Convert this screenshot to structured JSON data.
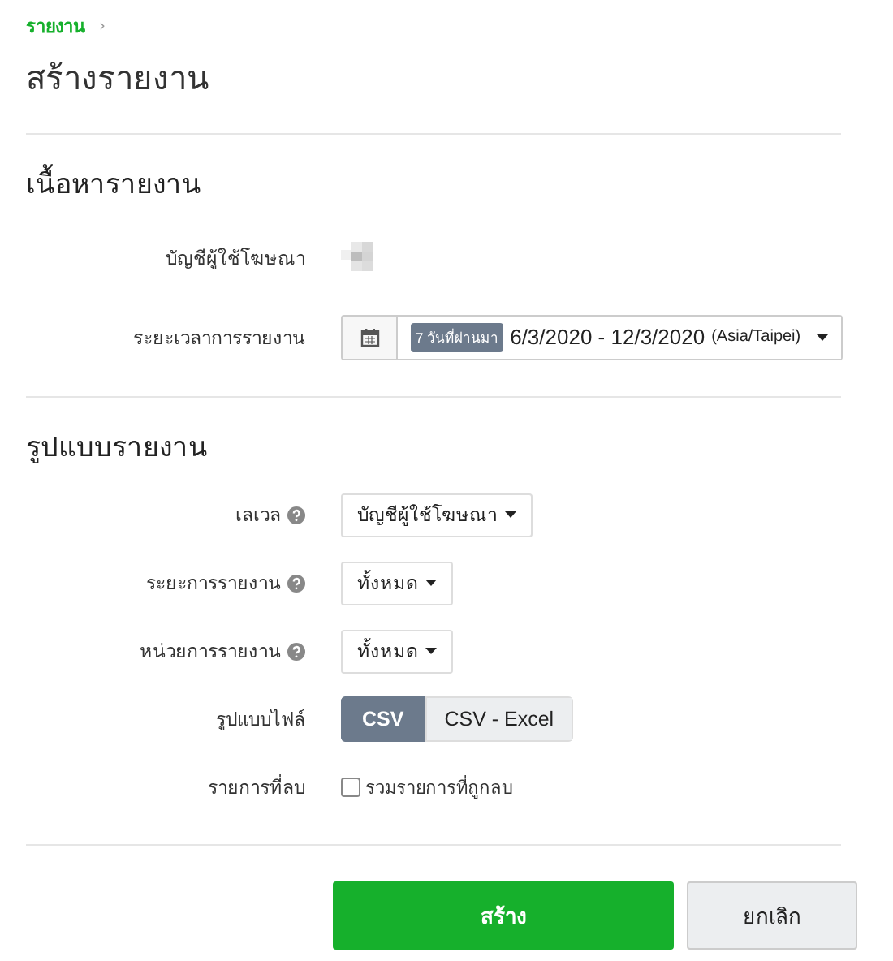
{
  "breadcrumb": {
    "link": "รายงาน",
    "separator": "›"
  },
  "title": "สร้างรายงาน",
  "sections": [
    {
      "title": "เนื้อหารายงาน",
      "rows": [
        {
          "kind": "picture",
          "label": "บัญชีผู้ใช้โฆษณา",
          "help": false
        },
        {
          "kind": "daterange",
          "label": "ระยะเวลาการรายงาน",
          "help": false,
          "badge": "7 วันที่ผ่านมา",
          "range": "6/3/2020 - 12/3/2020",
          "timezone": "(Asia/Taipei)"
        }
      ]
    },
    {
      "title": "รูปแบบรายงาน",
      "rows": [
        {
          "kind": "dropdown",
          "label": "เลเวล",
          "help": true,
          "value": "บัญชีผู้ใช้โฆษณา"
        },
        {
          "kind": "dropdown",
          "label": "ระยะการรายงาน",
          "help": true,
          "value": "ทั้งหมด"
        },
        {
          "kind": "dropdown",
          "label": "หน่วยการรายงาน",
          "help": true,
          "value": "ทั้งหมด"
        },
        {
          "kind": "segmented",
          "label": "รูปแบบไฟล์",
          "help": false,
          "options": [
            {
              "label": "CSV",
              "selected": true
            },
            {
              "label": "CSV - Excel",
              "selected": false
            }
          ]
        },
        {
          "kind": "checkbox",
          "label": "รายการที่ลบ",
          "help": false,
          "text": "รวมรายการที่ถูกลบ",
          "checked": false
        }
      ]
    }
  ],
  "buttons": [
    {
      "label": "สร้าง",
      "kind": "primary"
    },
    {
      "label": "ยกเลิก",
      "kind": "secondary"
    }
  ]
}
